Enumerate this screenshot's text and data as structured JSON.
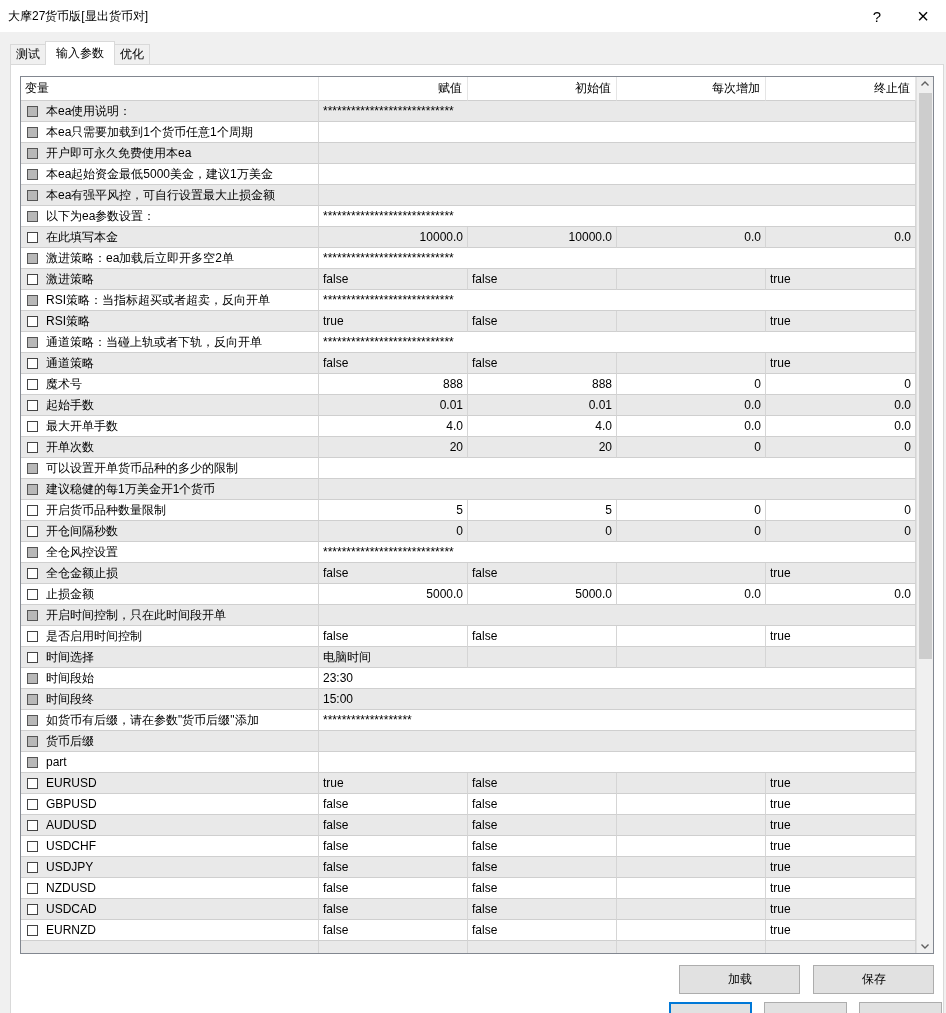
{
  "window": {
    "title": "大摩27货币版[显出货币对]",
    "help": "?",
    "close": "×"
  },
  "tabs": [
    {
      "label": "测试",
      "selected": false
    },
    {
      "label": "输入参数",
      "selected": true
    },
    {
      "label": "优化",
      "selected": false
    }
  ],
  "table": {
    "columns": [
      "变量",
      "赋值",
      "初始值",
      "每次增加",
      "终止值"
    ],
    "rows": [
      {
        "name": "本ea使用说明：",
        "kind": "note",
        "disabled": true,
        "value": "****************************"
      },
      {
        "name": "本ea只需要加载到1个货币任意1个周期",
        "kind": "note",
        "disabled": true
      },
      {
        "name": "开户即可永久免费使用本ea",
        "kind": "note",
        "disabled": true
      },
      {
        "name": "本ea起始资金最低5000美金，建议1万美金",
        "kind": "note",
        "disabled": true
      },
      {
        "name": "本ea有强平风控，可自行设置最大止损金额",
        "kind": "note",
        "disabled": true
      },
      {
        "name": "以下为ea参数设置：",
        "kind": "note",
        "disabled": true,
        "value": "****************************"
      },
      {
        "name": "在此填写本金",
        "kind": "number",
        "disabled": false,
        "value": "10000.0",
        "initial": "10000.0",
        "step": "0.0",
        "stop": "0.0"
      },
      {
        "name": "激进策略：ea加载后立即开多空2单",
        "kind": "note",
        "disabled": true,
        "value": "****************************"
      },
      {
        "name": "激进策略",
        "kind": "text",
        "disabled": false,
        "value": "false",
        "initial": "false",
        "stop": "true"
      },
      {
        "name": "RSI策略：当指标超买或者超卖，反向开单",
        "kind": "note",
        "disabled": true,
        "value": "****************************"
      },
      {
        "name": "RSI策略",
        "kind": "text",
        "disabled": false,
        "value": "true",
        "initial": "false",
        "stop": "true"
      },
      {
        "name": "通道策略：当碰上轨或者下轨，反向开单",
        "kind": "note",
        "disabled": true,
        "value": "****************************"
      },
      {
        "name": "通道策略",
        "kind": "text",
        "disabled": false,
        "value": "false",
        "initial": "false",
        "stop": "true"
      },
      {
        "name": "魔术号",
        "kind": "number",
        "disabled": false,
        "value": "888",
        "initial": "888",
        "step": "0",
        "stop": "0"
      },
      {
        "name": "起始手数",
        "kind": "number",
        "disabled": false,
        "value": "0.01",
        "initial": "0.01",
        "step": "0.0",
        "stop": "0.0"
      },
      {
        "name": "最大开单手数",
        "kind": "number",
        "disabled": false,
        "value": "4.0",
        "initial": "4.0",
        "step": "0.0",
        "stop": "0.0"
      },
      {
        "name": "开单次数",
        "kind": "number",
        "disabled": false,
        "value": "20",
        "initial": "20",
        "step": "0",
        "stop": "0"
      },
      {
        "name": "可以设置开单货币品种的多少的限制",
        "kind": "note",
        "disabled": true
      },
      {
        "name": "建议稳健的每1万美金开1个货币",
        "kind": "note",
        "disabled": true
      },
      {
        "name": "开启货币品种数量限制",
        "kind": "number",
        "disabled": false,
        "value": "5",
        "initial": "5",
        "step": "0",
        "stop": "0"
      },
      {
        "name": "开仓间隔秒数",
        "kind": "number",
        "disabled": false,
        "value": "0",
        "initial": "0",
        "step": "0",
        "stop": "0"
      },
      {
        "name": "全仓风控设置",
        "kind": "note",
        "disabled": true,
        "value": "****************************"
      },
      {
        "name": "全仓金额止损",
        "kind": "text",
        "disabled": false,
        "value": "false",
        "initial": "false",
        "stop": "true"
      },
      {
        "name": "止损金额",
        "kind": "number",
        "disabled": false,
        "value": "5000.0",
        "initial": "5000.0",
        "step": "0.0",
        "stop": "0.0"
      },
      {
        "name": "开启时间控制，只在此时间段开单",
        "kind": "note",
        "disabled": true
      },
      {
        "name": "是否启用时间控制",
        "kind": "text",
        "disabled": false,
        "value": "false",
        "initial": "false",
        "stop": "true"
      },
      {
        "name": "时间选择",
        "kind": "text",
        "disabled": false,
        "value": "电脑时间"
      },
      {
        "name": "时间段始",
        "kind": "note",
        "disabled": true,
        "value": "23:30"
      },
      {
        "name": "时间段终",
        "kind": "note",
        "disabled": true,
        "value": "15:00"
      },
      {
        "name": "如货币有后缀，请在参数\"货币后缀\"添加",
        "kind": "note",
        "disabled": true,
        "value": "*******************"
      },
      {
        "name": "货币后缀",
        "kind": "note",
        "disabled": true
      },
      {
        "name": "part",
        "kind": "note",
        "disabled": true
      },
      {
        "name": "EURUSD",
        "kind": "text",
        "disabled": false,
        "value": "true",
        "initial": "false",
        "stop": "true"
      },
      {
        "name": "GBPUSD",
        "kind": "text",
        "disabled": false,
        "value": "false",
        "initial": "false",
        "stop": "true"
      },
      {
        "name": "AUDUSD",
        "kind": "text",
        "disabled": false,
        "value": "false",
        "initial": "false",
        "stop": "true"
      },
      {
        "name": "USDCHF",
        "kind": "text",
        "disabled": false,
        "value": "false",
        "initial": "false",
        "stop": "true"
      },
      {
        "name": "USDJPY",
        "kind": "text",
        "disabled": false,
        "value": "false",
        "initial": "false",
        "stop": "true"
      },
      {
        "name": "NZDUSD",
        "kind": "text",
        "disabled": false,
        "value": "false",
        "initial": "false",
        "stop": "true"
      },
      {
        "name": "USDCAD",
        "kind": "text",
        "disabled": false,
        "value": "false",
        "initial": "false",
        "stop": "true"
      },
      {
        "name": "EURNZD",
        "kind": "text",
        "disabled": false,
        "value": "false",
        "initial": "false",
        "stop": "true"
      }
    ]
  },
  "buttons": [
    "加载",
    "保存"
  ]
}
